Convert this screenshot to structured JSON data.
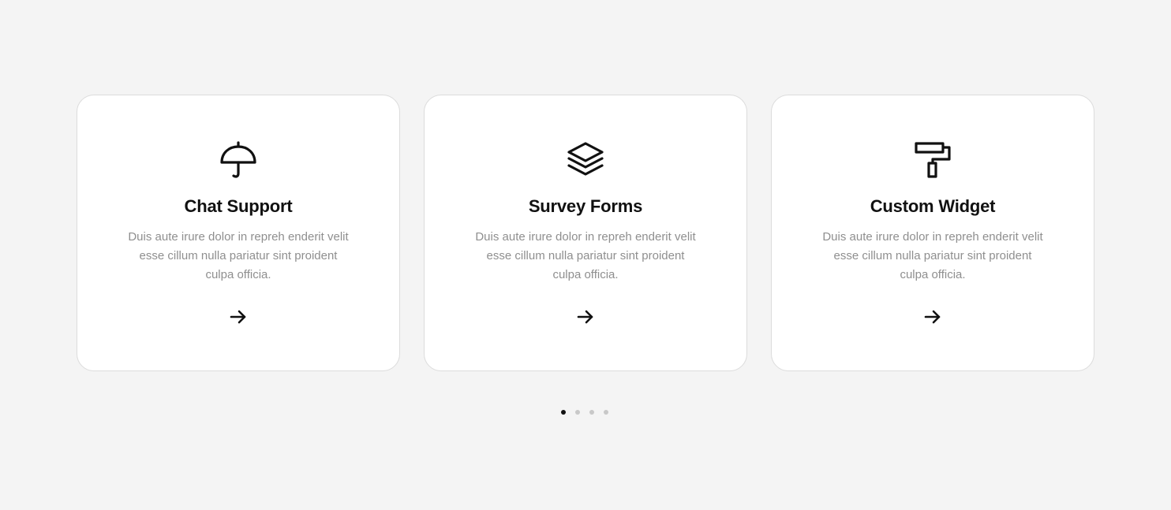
{
  "cards": [
    {
      "icon": "umbrella-icon",
      "title": "Chat Support",
      "description": "Duis aute irure dolor in repreh enderit velit esse cillum nulla pariatur sint proident culpa officia.",
      "arrow_icon": "arrow-right-icon"
    },
    {
      "icon": "layers-icon",
      "title": "Survey Forms",
      "description": "Duis aute irure dolor in repreh enderit velit esse cillum nulla pariatur sint proident culpa officia.",
      "arrow_icon": "arrow-right-icon"
    },
    {
      "icon": "paint-roller-icon",
      "title": "Custom Widget",
      "description": "Duis aute irure dolor in repreh enderit velit esse cillum nulla pariatur sint proident culpa officia.",
      "arrow_icon": "arrow-right-icon"
    }
  ],
  "pagination": {
    "total": 4,
    "active_index": 0
  },
  "colors": {
    "background": "#f4f4f4",
    "card": "#ffffff",
    "text_primary": "#111111",
    "text_secondary": "#8f8f8f",
    "dot_inactive": "#c8c8c8",
    "dot_active": "#111111"
  }
}
